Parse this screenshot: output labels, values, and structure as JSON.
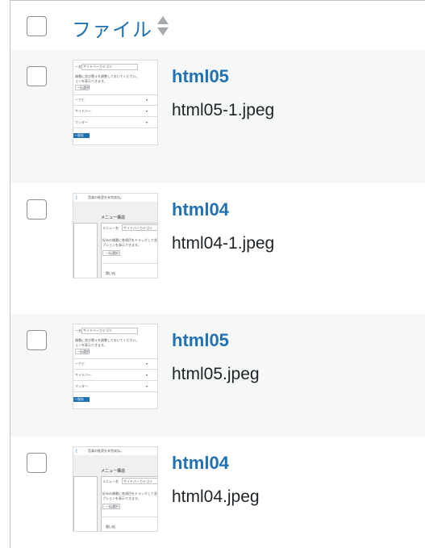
{
  "header": {
    "column_title": "ファイル"
  },
  "rows": [
    {
      "title": "html05",
      "filename": "html05-1.jpeg",
      "thumb": "A",
      "alt": true
    },
    {
      "title": "html04",
      "filename": "html04-1.jpeg",
      "thumb": "B",
      "alt": false
    },
    {
      "title": "html05",
      "filename": "html05.jpeg",
      "thumb": "A",
      "alt": true
    },
    {
      "title": "html04",
      "filename": "html04.jpeg",
      "thumb": "B",
      "alt": false
    }
  ],
  "thumbs": {
    "A": {
      "menu_name_label": "ー名",
      "menu_name_value": "サイドバーカテゴリ",
      "desc": "順番に並び替えを調整しておいてください。",
      "desc2": "ョンを表示できます。",
      "select_all": "一括選択",
      "rows": [
        "ーナビ",
        "サイドバー",
        "フッター"
      ],
      "save": "ー保存"
    },
    "B": {
      "top_text": "音楽の推奨を未完成ね。",
      "link": "と",
      "heading": "メニュー構造",
      "menu_name_label": "メニュー名",
      "menu_name_value": "サイドバーカテゴリ",
      "desc": "好みの順番に各項目をドラッグして並び替え、",
      "desc2": "プションを表示できます。",
      "select_all": "一括選択",
      "footer_label": "思い出"
    }
  }
}
